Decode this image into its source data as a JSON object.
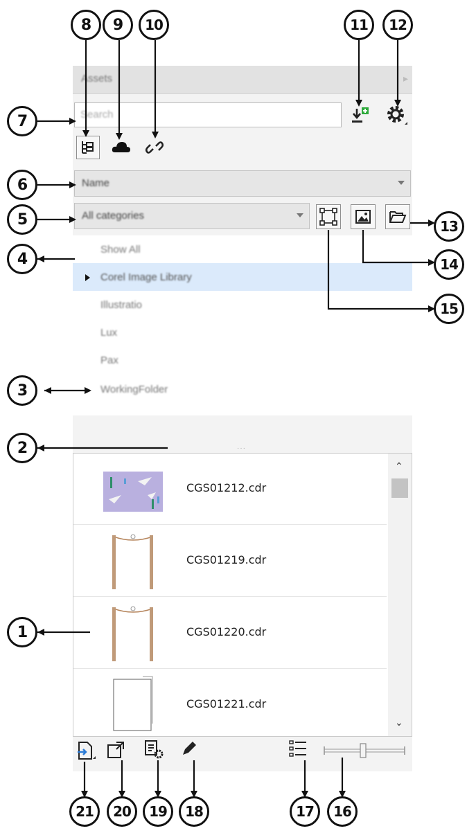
{
  "panel": {
    "title": "Assets",
    "search_placeholder": "Search",
    "sort_value": "Name",
    "category_value": "All categories"
  },
  "tree": {
    "items": [
      "Show All",
      "Corel Image Library",
      "Illustratio",
      "Lux",
      "Pax",
      "WorkingFolder"
    ],
    "selected_index": 1
  },
  "files": [
    {
      "name": "CGS01212.cdr",
      "thumb": "purple-illustration"
    },
    {
      "name": "CGS01219.cdr",
      "thumb": "wooden-posts"
    },
    {
      "name": "CGS01220.cdr",
      "thumb": "wooden-posts"
    },
    {
      "name": "CGS01221.cdr",
      "thumb": "blank-page"
    }
  ],
  "callouts": [
    "1",
    "2",
    "3",
    "4",
    "5",
    "6",
    "7",
    "8",
    "9",
    "10",
    "11",
    "12",
    "13",
    "14",
    "15",
    "16",
    "17",
    "18",
    "19",
    "20",
    "21"
  ],
  "colors": {
    "selection": "#dbeafb",
    "accent_green": "#2eaa3c",
    "panel_bg": "#f3f3f3"
  }
}
